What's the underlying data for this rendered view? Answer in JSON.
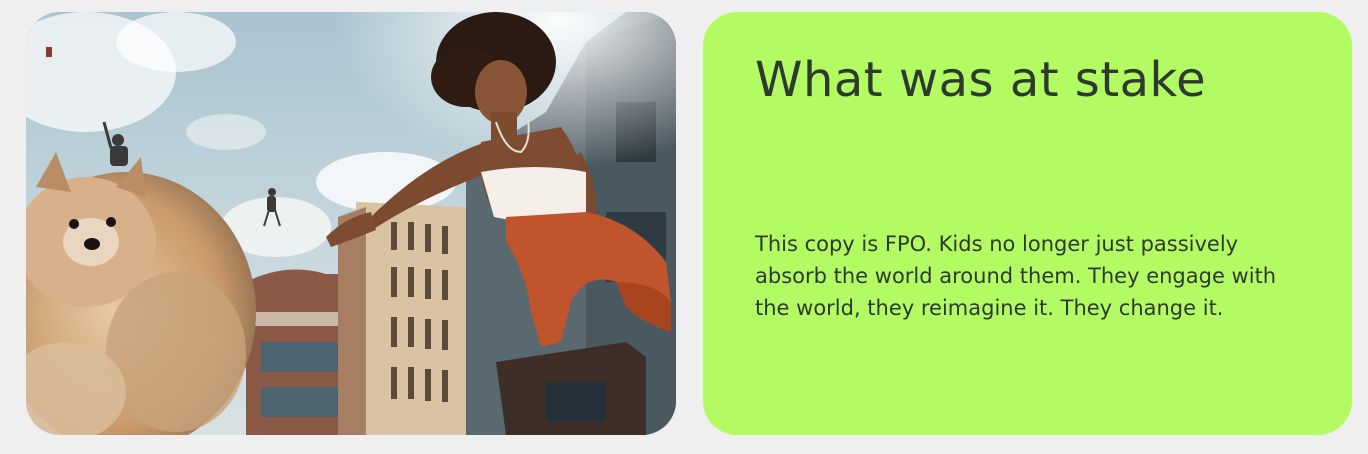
{
  "media": {
    "alt": "Woman in white top and orange pants flying over city buildings reaching toward a fluffy pomeranian dog"
  },
  "content": {
    "heading": "What was at stake",
    "body": "This copy is FPO. Kids no longer just passively absorb the world around them. They engage with the world, they reimagine it. They change it."
  },
  "colors": {
    "page_background": "#efefef",
    "card_accent": "#b3fb62",
    "text": "#2f3a2f"
  }
}
